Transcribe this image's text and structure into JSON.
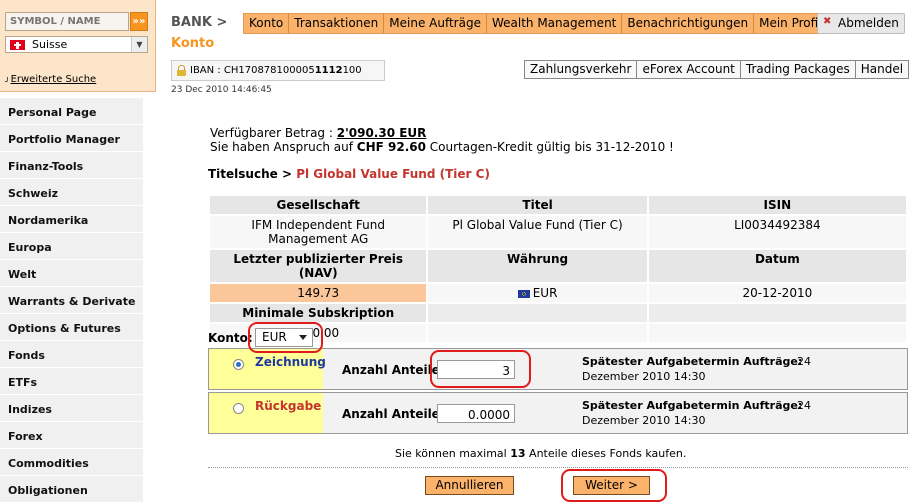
{
  "search": {
    "placeholder": "SYMBOL / NAME",
    "go": "»»",
    "market": "Suisse",
    "advanced_icon": "ᴊ",
    "advanced": "Erweiterte Suche"
  },
  "sidebar": {
    "items": [
      {
        "label": "Personal Page"
      },
      {
        "label": "Portfolio Manager"
      },
      {
        "label": "Finanz-Tools"
      },
      {
        "label": "Schweiz"
      },
      {
        "label": "Nordamerika"
      },
      {
        "label": "Europa"
      },
      {
        "label": "Welt"
      },
      {
        "label": "Warrants & Derivate"
      },
      {
        "label": "Options & Futures"
      },
      {
        "label": "Fonds"
      },
      {
        "label": "ETFs"
      },
      {
        "label": "Indizes"
      },
      {
        "label": "Forex"
      },
      {
        "label": "Commodities"
      },
      {
        "label": "Obligationen"
      }
    ]
  },
  "header": {
    "brand": "BANK >",
    "section": "Konto",
    "tabs": [
      "Konto",
      "Transaktionen",
      "Meine Aufträge",
      "Wealth Management",
      "Benachrichtigungen",
      "Mein Profil"
    ],
    "logout": "Abmelden",
    "logout_icon": "✖",
    "iban_prefix": "IBAN : CH170878100005",
    "iban_bold": "1112",
    "iban_suffix": "100",
    "datetime": "23 Dec 2010 14:46:45",
    "subtabs": [
      "Zahlungsverkehr",
      "eForex Account",
      "Trading Packages",
      "Handel"
    ]
  },
  "main": {
    "available_label": "Verfügbarer Betrag : ",
    "available_amount": "2'090.30 EUR",
    "credit_prefix": "Sie haben Anspruch auf ",
    "credit_amount": "CHF 92.60",
    "credit_suffix": " Courtagen-Kredit gültig bis 31-12-2010 !",
    "heading_prefix": "Titelsuche > ",
    "heading_fund": "Pl Global Value Fund (Tier C)"
  },
  "table": {
    "h_company": "Gesellschaft",
    "h_title": "Titel",
    "h_isin": "ISIN",
    "company": "IFM Independent Fund Management AG",
    "title": "Pl Global Value Fund (Tier C)",
    "isin": "LI0034492384",
    "h_nav": "Letzter publizierter Preis (NAV)",
    "h_currency": "Währung",
    "h_date": "Datum",
    "nav": "149.73",
    "currency": "EUR",
    "date": "20-12-2010",
    "h_min": "Minimale Subskription",
    "min": "100.00"
  },
  "order": {
    "konto_label": "Konto:",
    "konto_value": "EUR",
    "subscribe_label": "Zeichnung",
    "redeem_label": "Rückgabe",
    "qty_label": "Anzahl Anteile:",
    "subscribe_qty": "3",
    "redeem_qty": "0.0000",
    "deadline_label": "Spätester Aufgabetermin Aufträge:",
    "deadline_day": "24",
    "deadline_rest": "Dezember 2010 14:30",
    "max_prefix": "Sie können maximal ",
    "max_count": "13",
    "max_suffix": " Anteile dieses Fonds kaufen."
  },
  "buttons": {
    "cancel": "Annullieren",
    "next": "Weiter  >"
  },
  "colors": {
    "accent_orange": "#fbb36b",
    "brand_orange": "#f7941d",
    "highlight_red": "#e01b1b",
    "fund_red": "#c3352e",
    "subscribe_blue": "#1f3a9e"
  }
}
